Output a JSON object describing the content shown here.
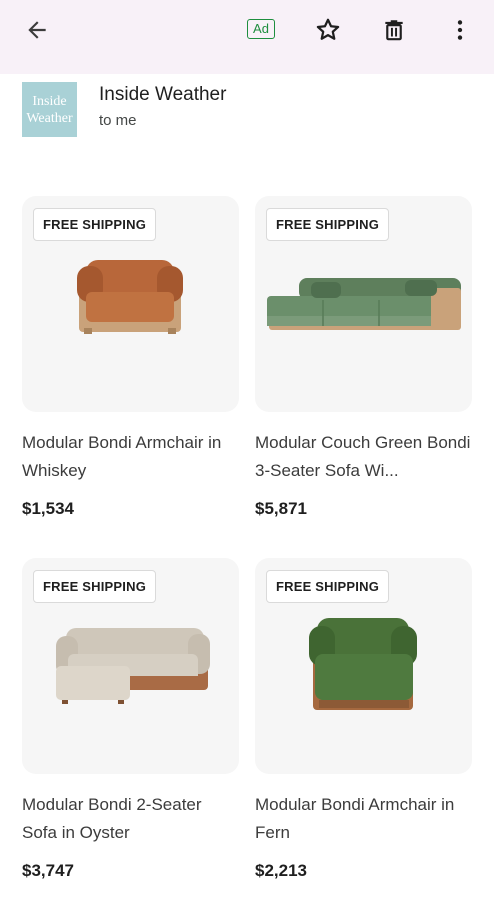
{
  "toolbar": {
    "ad_label": "Ad",
    "back_icon": "arrow-back-icon",
    "star_icon": "star-outline-icon",
    "delete_icon": "trash-icon",
    "more_icon": "more-vert-icon"
  },
  "sender": {
    "logo_line1": "Inside",
    "logo_line2": "Weather",
    "name": "Inside Weather",
    "to": "to me"
  },
  "products": [
    {
      "badge": "FREE SHIPPING",
      "title": "Modular Bondi Armchair in Whiskey",
      "price": "$1,534",
      "color": "#b8673a"
    },
    {
      "badge": "FREE SHIPPING",
      "title": "Modular Couch Green Bondi 3-Seater Sofa Wi...",
      "price": "$5,871",
      "color": "#6b8f6b"
    },
    {
      "badge": "FREE SHIPPING",
      "title": "Modular Bondi 2-Seater Sofa in Oyster",
      "price": "$3,747",
      "color": "#d6cfc3"
    },
    {
      "badge": "FREE SHIPPING",
      "title": "Modular Bondi Armchair in Fern",
      "price": "$2,213",
      "color": "#4f7a3f"
    }
  ],
  "colors": {
    "topbar_bg": "#f8f1f8",
    "ad_green": "#1e8e3e",
    "logo_bg": "#a9d1d6",
    "wood": "#c9a27a"
  }
}
